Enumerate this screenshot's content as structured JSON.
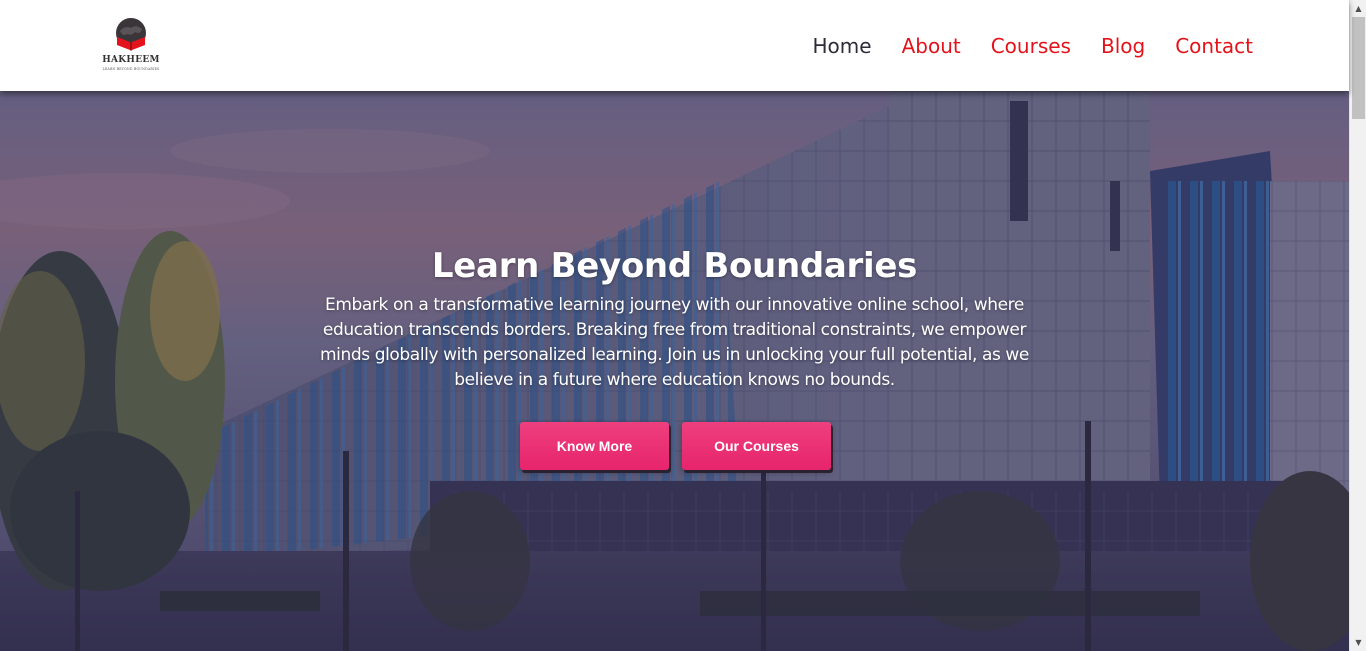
{
  "brand": {
    "name": "HAKHEEM",
    "tagline": "LEARN BEYOND BOUNDARIES",
    "logo_icon": "book-globe-icon",
    "accent_color": "#e4131b"
  },
  "nav": {
    "items": [
      {
        "label": "Home",
        "active": true
      },
      {
        "label": "About",
        "active": false
      },
      {
        "label": "Courses",
        "active": false
      },
      {
        "label": "Blog",
        "active": false
      },
      {
        "label": "Contact",
        "active": false
      }
    ]
  },
  "hero": {
    "title": "Learn Beyond Boundaries",
    "text": "Embark on a transformative learning journey with our innovative online school, where education transcends borders. Breaking free from traditional constraints, we empower minds globally with personalized learning. Join us in unlocking your full potential, as we believe in a future where education knows no bounds.",
    "background": "campus-building-photo",
    "buttons": {
      "primary": "Know More",
      "secondary": "Our Courses"
    },
    "button_color": "#e7246c"
  },
  "scrollbar": {
    "up_icon": "scroll-up-arrow-icon",
    "down_icon": "scroll-down-arrow-icon"
  }
}
